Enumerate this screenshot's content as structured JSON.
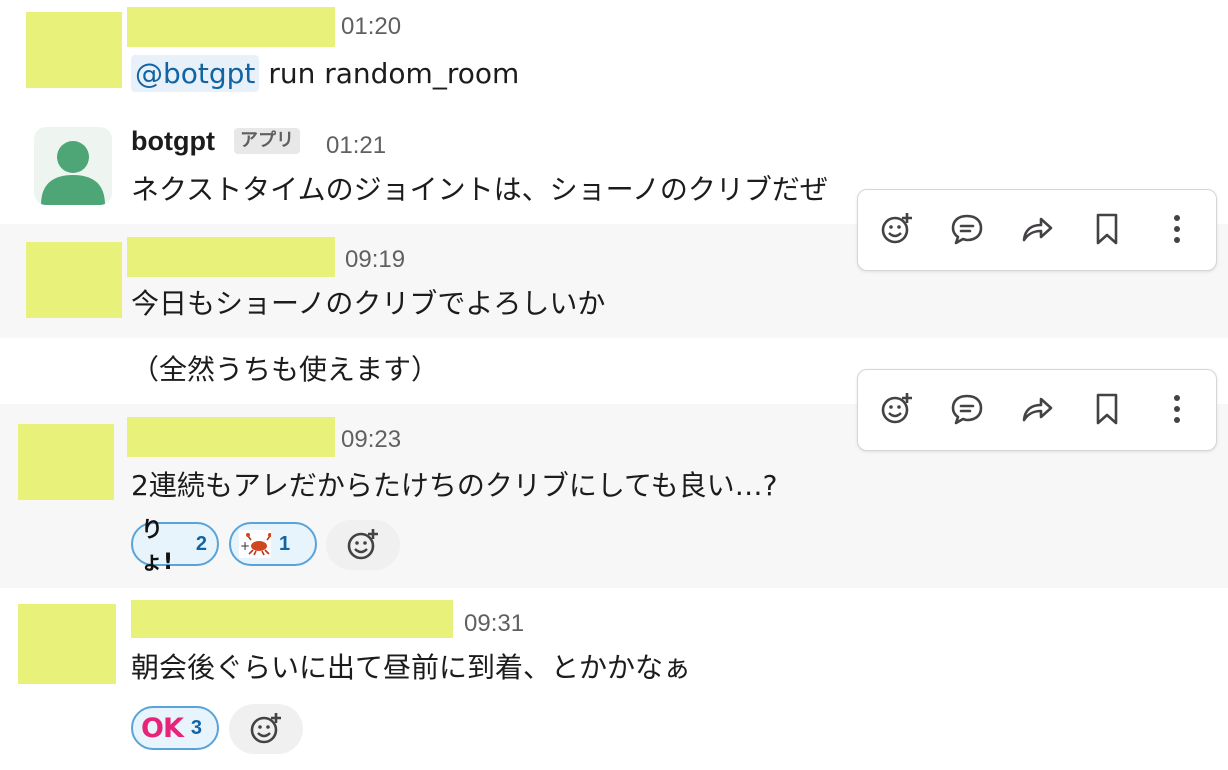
{
  "messages": [
    {
      "time": "01:20",
      "text_mention": "@botgpt",
      "text": " run random_room"
    },
    {
      "name": "botgpt",
      "app_badge": "アプリ",
      "time": "01:21",
      "text": "ネクストタイムのジョイントは、ショーノのクリブだぜ"
    },
    {
      "time": "09:19",
      "text": "今日もショーノのクリブでよろしいか"
    },
    {
      "text": "（全然うちも使えます）"
    },
    {
      "time": "09:23",
      "text": "2連続もアレだからたけちのクリブにしても良い…?",
      "reactions": [
        {
          "label": "りょ!",
          "count": "2"
        },
        {
          "count": "1",
          "icon": "crab-icon"
        }
      ]
    },
    {
      "time": "09:31",
      "text": "朝会後ぐらいに出て昼前に到着、とかかなぁ",
      "reactions": [
        {
          "label": "OK",
          "count": "3"
        }
      ]
    }
  ],
  "toolbar_actions": [
    "add-reaction-icon",
    "reply-in-thread-icon",
    "share-message-icon",
    "save-bookmark-icon",
    "more-actions-icon"
  ],
  "colors": {
    "redaction": "#e8f27a",
    "link": "#1264a3",
    "hover_row": "#f7f7f7",
    "reaction_border": "#5aa3d8",
    "ok_pink": "#e8247a"
  }
}
